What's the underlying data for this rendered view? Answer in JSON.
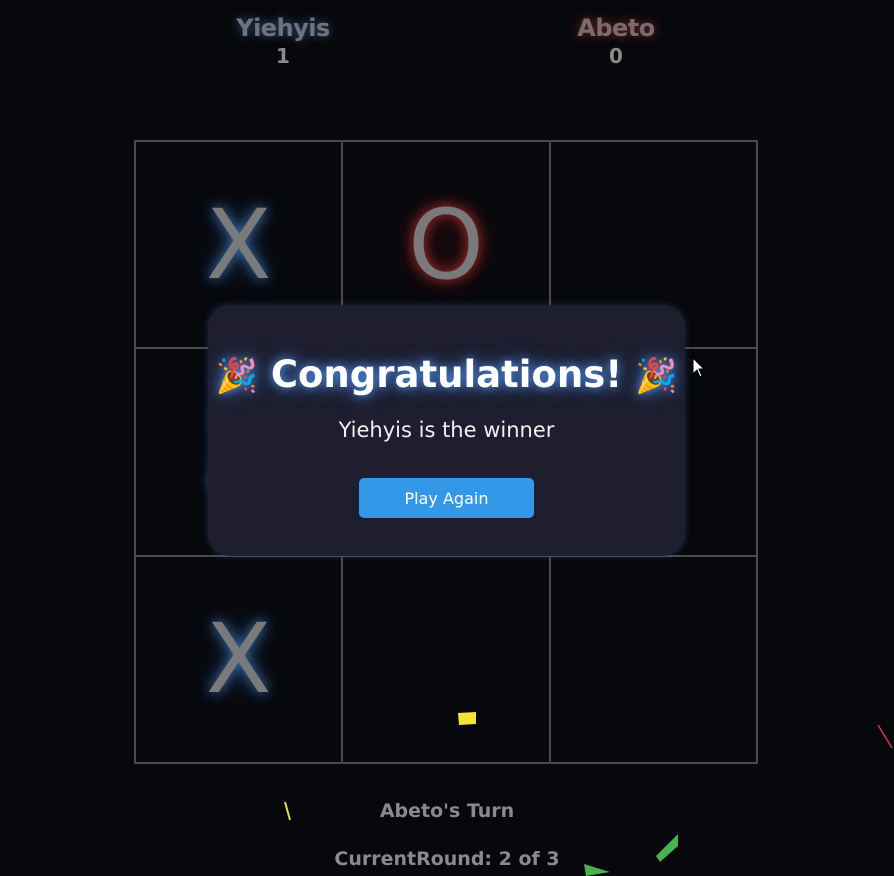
{
  "players": [
    {
      "name": "Yiehyis",
      "score": "1"
    },
    {
      "name": "Abeto",
      "score": "0"
    }
  ],
  "board": {
    "cells": [
      "X",
      "O",
      "",
      "X",
      "",
      "",
      "X",
      "",
      ""
    ]
  },
  "modal": {
    "party_emoji": "🎉",
    "title": "Congratulations!",
    "message": "Yiehyis is the winner",
    "button_label": "Play Again"
  },
  "status": {
    "turn_text": "Abeto's Turn",
    "round_text": "CurrentRound: 2 of 3"
  },
  "colors": {
    "background": "#07080c",
    "modal_bg": "#1e1e2e",
    "button_bg": "#3498e8",
    "x_glow": "#4f96e6",
    "o_glow": "#e63c3c"
  }
}
